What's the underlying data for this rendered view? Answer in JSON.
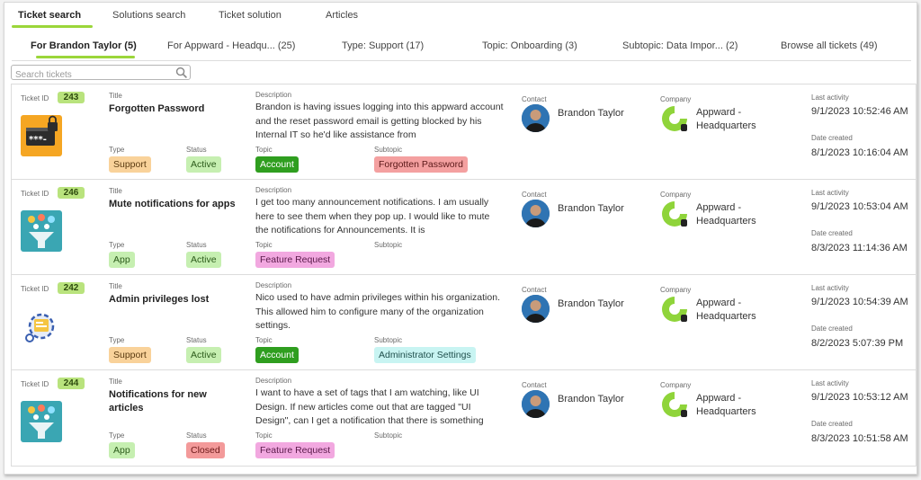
{
  "tabs": [
    {
      "label": "Ticket search"
    },
    {
      "label": "Solutions search"
    },
    {
      "label": "Ticket solution"
    },
    {
      "label": "Articles"
    }
  ],
  "filters": [
    {
      "label": "For Brandon Taylor (5)"
    },
    {
      "label": "For Appward - Headqu... (25)"
    },
    {
      "label": "Type: Support (17)"
    },
    {
      "label": "Topic: Onboarding (3)"
    },
    {
      "label": "Subtopic: Data Impor... (2)"
    },
    {
      "label": "Browse all tickets (49)"
    }
  ],
  "search": {
    "placeholder": "Search tickets",
    "icon": "search-icon"
  },
  "labels": {
    "ticket_id": "Ticket ID",
    "title": "Title",
    "description": "Description",
    "contact": "Contact",
    "company": "Company",
    "last_activity": "Last activity",
    "date_created": "Date created",
    "type": "Type",
    "status": "Status",
    "topic": "Topic",
    "subtopic": "Subtopic"
  },
  "colors": {
    "accent": "#9bd63a",
    "id_badge": "#b9e37d",
    "type_chip": "#f9d29a",
    "status_active": "#c6efb1",
    "status_closed": "#f39a9a",
    "topic_account": "#2f9e1f",
    "topic_feature": "#f2a8e0",
    "subtopic_forgot": "#f4a0a0",
    "subtopic_admin": "#c8f4f2",
    "company_logo": "#8fd43a"
  },
  "tickets": [
    {
      "id": "243",
      "icon": "password-lock-icon",
      "title": "Forgotten Password",
      "description": "Brandon is having issues logging into this appward account and the reset password email is getting blocked by his Internal IT so he'd like assistance from",
      "type": "Support",
      "status": "Active",
      "topic": "Account",
      "subtopic": "Forgotten Password",
      "contact": "Brandon Taylor",
      "company": "Appward - Headquarters",
      "last_activity": "9/1/2023 10:52:46 AM",
      "date_created": "8/1/2023 10:16:04 AM"
    },
    {
      "id": "246",
      "icon": "notification-funnel-icon",
      "title": "Mute notifications for apps",
      "description": "I get too many announcement notifications. I am usually here to see them when they pop up. I would like to mute the notifications for Announcements. It is",
      "type": "App",
      "status": "Active",
      "topic": "Feature Request",
      "subtopic": "",
      "contact": "Brandon Taylor",
      "company": "Appward - Headquarters",
      "last_activity": "9/1/2023 10:53:04 AM",
      "date_created": "8/3/2023 11:14:36 AM"
    },
    {
      "id": "242",
      "icon": "admin-settings-icon",
      "title": "Admin privileges lost",
      "description": "Nico used to have admin privileges within his organization. This allowed him to configure many of the organization settings.",
      "type": "Support",
      "status": "Active",
      "topic": "Account",
      "subtopic": "Administrator Settings",
      "contact": "Brandon Taylor",
      "company": "Appward - Headquarters",
      "last_activity": "9/1/2023 10:54:39 AM",
      "date_created": "8/2/2023 5:07:39 PM"
    },
    {
      "id": "244",
      "icon": "notification-funnel-icon",
      "title": "Notifications for new articles",
      "description": "I want to have a set of tags that I am watching, like UI Design. If new articles come out that are tagged \"UI Design\", can I get a notification that there is something",
      "type": "App",
      "status": "Closed",
      "topic": "Feature Request",
      "subtopic": "",
      "contact": "Brandon Taylor",
      "company": "Appward - Headquarters",
      "last_activity": "9/1/2023 10:53:12 AM",
      "date_created": "8/3/2023 10:51:58 AM"
    }
  ]
}
